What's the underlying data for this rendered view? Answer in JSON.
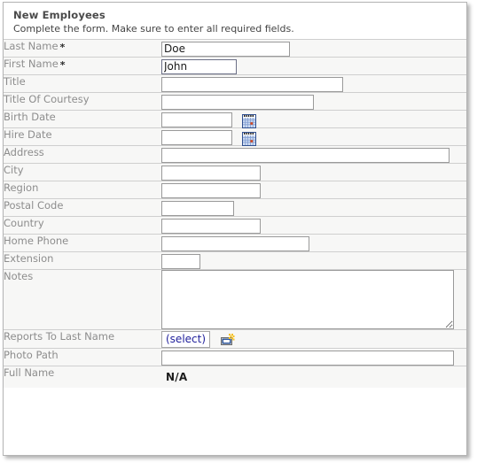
{
  "panel": {
    "title": "New Employees",
    "subtitle": "Complete the form. Make sure to enter all required fields.",
    "required_marker": "*"
  },
  "colors": {
    "panel_border": "#b4b4b4",
    "row_background": "#f7f7f6",
    "row_divider": "#cfcfcf",
    "label_text": "#8d8d8d",
    "title_text": "#4a4a4a",
    "link_blue": "#22229c",
    "input_border": "#9a9a9a",
    "focused_input_border": "#6b6f86",
    "calendar_icon_blue": "#3b5fa8",
    "calendar_icon_accent": "#d4471f",
    "lookup_icon_gold": "#f5c020"
  },
  "fields": {
    "last_name": {
      "label": "Last Name",
      "value": "Doe",
      "placeholder": "",
      "required": true,
      "focused": false
    },
    "first_name": {
      "label": "First Name",
      "value": "John",
      "placeholder": "",
      "required": true,
      "focused": true
    },
    "title": {
      "label": "Title",
      "value": "",
      "placeholder": "",
      "required": false,
      "focused": false
    },
    "title_of_courtesy": {
      "label": "Title Of Courtesy",
      "value": "",
      "placeholder": "",
      "required": false,
      "focused": false
    },
    "birth_date": {
      "label": "Birth Date",
      "value": "",
      "placeholder": "",
      "required": false,
      "focused": false,
      "icon": "calendar-icon"
    },
    "hire_date": {
      "label": "Hire Date",
      "value": "",
      "placeholder": "",
      "required": false,
      "focused": false,
      "icon": "calendar-icon"
    },
    "address": {
      "label": "Address",
      "value": "",
      "placeholder": "",
      "required": false,
      "focused": false
    },
    "city": {
      "label": "City",
      "value": "",
      "placeholder": "",
      "required": false,
      "focused": false
    },
    "region": {
      "label": "Region",
      "value": "",
      "placeholder": "",
      "required": false,
      "focused": false
    },
    "postal_code": {
      "label": "Postal Code",
      "value": "",
      "placeholder": "",
      "required": false,
      "focused": false
    },
    "country": {
      "label": "Country",
      "value": "",
      "placeholder": "",
      "required": false,
      "focused": false
    },
    "home_phone": {
      "label": "Home Phone",
      "value": "",
      "placeholder": "",
      "required": false,
      "focused": false
    },
    "extension": {
      "label": "Extension",
      "value": "",
      "placeholder": "",
      "required": false,
      "focused": false
    },
    "notes": {
      "label": "Notes",
      "value": "",
      "placeholder": "",
      "required": false,
      "focused": false
    },
    "reports_to_last_name": {
      "label": "Reports To Last Name",
      "select_label": "(select)",
      "icon": "lookup-icon",
      "required": false
    },
    "photo_path": {
      "label": "Photo Path",
      "value": "",
      "placeholder": "",
      "required": false,
      "focused": false
    },
    "full_name": {
      "label": "Full Name",
      "value": "N/A",
      "readonly": true
    }
  }
}
